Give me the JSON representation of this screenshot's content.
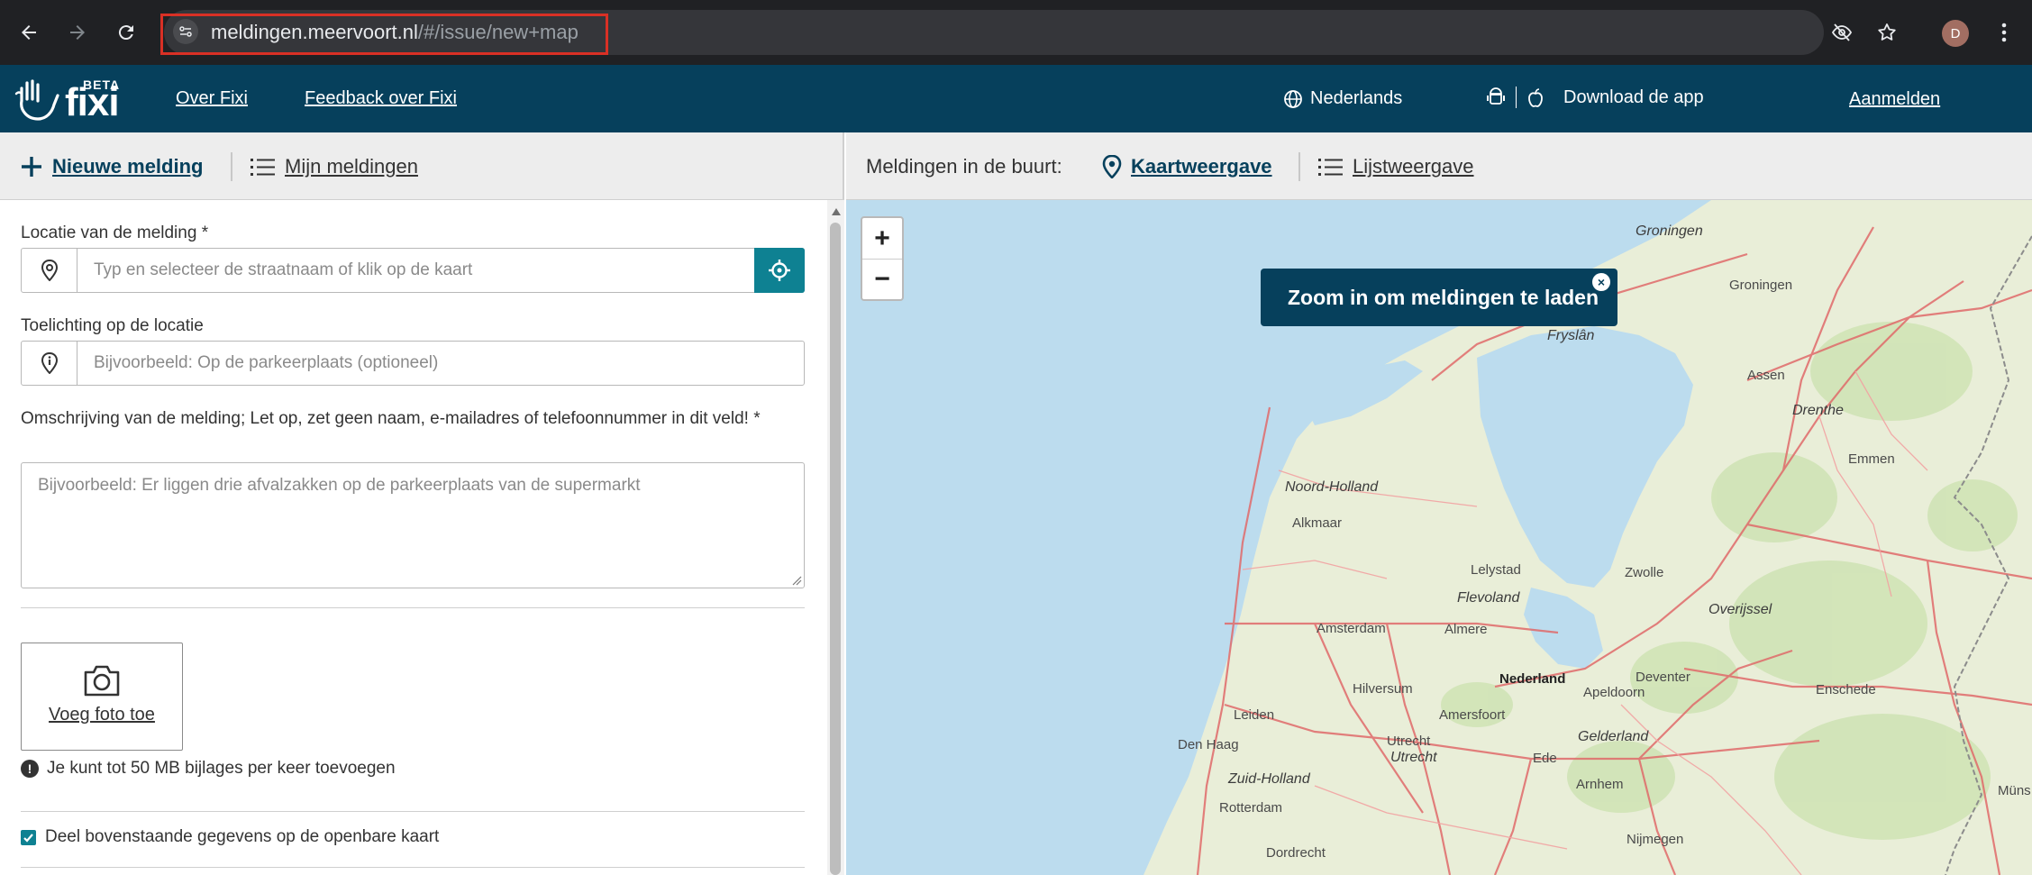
{
  "browser": {
    "url_host": "meldingen.meervoort.nl",
    "url_path": "/#/issue/new+map",
    "profile_initial": "D"
  },
  "header": {
    "logo_beta": "BETA",
    "logo_text": "fixi",
    "nav": [
      "Over Fixi",
      "Feedback over Fixi"
    ],
    "language": "Nederlands",
    "download_app": "Download de app",
    "login": "Aanmelden",
    "bg_color": "#06405c"
  },
  "subnav": {
    "new_report": "Nieuwe melding",
    "my_reports": "Mijn meldingen",
    "nearby_label": "Meldingen in de buurt:",
    "map_view": "Kaartweergave",
    "list_view": "Lijstweergave"
  },
  "form": {
    "location_label": "Locatie van de melding *",
    "location_placeholder": "Typ en selecteer de straatnaam of klik op de kaart",
    "location_note_label": "Toelichting op de locatie",
    "location_note_placeholder": "Bijvoorbeeld: Op de parkeerplaats (optioneel)",
    "description_label": "Omschrijving van de melding; Let op, zet geen naam, e-mailadres of telefoonnummer in dit veld! *",
    "description_placeholder": "Bijvoorbeeld: Er liggen drie afvalzakken op de parkeerplaats van de supermarkt",
    "add_photo": "Voeg foto toe",
    "attachment_note": "Je kunt tot 50 MB bijlages per keer toevoegen",
    "share_checkbox": "Deel bovenstaande gegevens op de openbare kaart",
    "share_checked": true,
    "accent_color": "#0e8192"
  },
  "map": {
    "zoom_in": "+",
    "zoom_out": "−",
    "tooltip": "Zoom in om meldingen te laden",
    "places": [
      "Groningen",
      "Groningen",
      "Fryslân",
      "Assen",
      "Drenthe",
      "Emmen",
      "Noord-Holland",
      "Alkmaar",
      "Lelystad",
      "Flevoland",
      "Zwolle",
      "Overijssel",
      "Amsterdam",
      "Almere",
      "Nederland",
      "Deventer",
      "Enschede",
      "Hilversum",
      "Apeldoorn",
      "Leiden",
      "Amersfoort",
      "Gelderland",
      "Utrecht",
      "Utrecht",
      "Den Haag",
      "Ede",
      "Zuid-Holland",
      "Arnhem",
      "Rotterdam",
      "Nijmegen",
      "Dordrecht",
      "Müns"
    ]
  }
}
